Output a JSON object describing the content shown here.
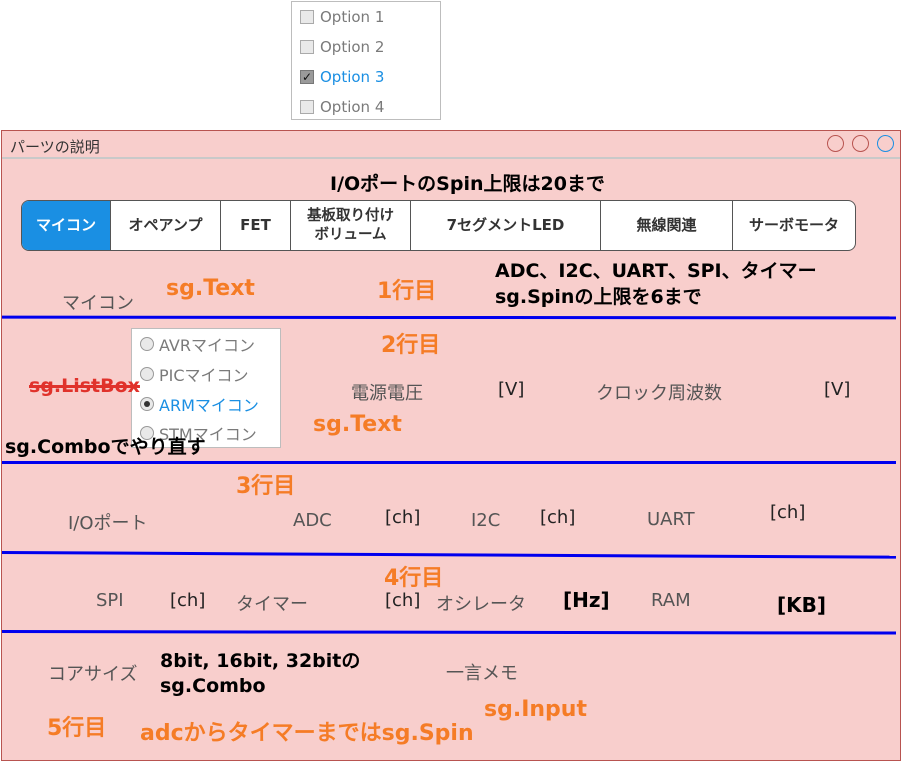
{
  "checklist": {
    "items": [
      {
        "label": "Option 1",
        "checked": false
      },
      {
        "label": "Option 2",
        "checked": false
      },
      {
        "label": "Option 3",
        "checked": true
      },
      {
        "label": "Option 4",
        "checked": false
      }
    ]
  },
  "window": {
    "title": "パーツの説明",
    "buttons": [
      "close",
      "minimize",
      "maximize"
    ]
  },
  "heading": "I/OポートのSpin上限は20まで",
  "tabs": [
    {
      "label": "マイコン",
      "active": true
    },
    {
      "label": "オペアンプ",
      "active": false
    },
    {
      "label": "FET",
      "active": false
    },
    {
      "label": "基板取り付け\nボリューム",
      "active": false
    },
    {
      "label": "7セグメントLED",
      "active": false
    },
    {
      "label": "無線関連",
      "active": false
    },
    {
      "label": "サーボモータ",
      "active": false
    }
  ],
  "row1": {
    "label": "マイコン",
    "annotation_text": "sg.Text",
    "row_marker": "1行目",
    "note_line1": "ADC、I2C、UART、SPI、タイマー",
    "note_line2": "sg.Spinの上限を6まで"
  },
  "row2": {
    "row_marker": "2行目",
    "listbox_strike": "sg.ListBox",
    "combo_note": "sg.Comboでやり直す",
    "annotation_text": "sg.Text",
    "radio_items": [
      {
        "label": "AVRマイコン",
        "selected": false
      },
      {
        "label": "PICマイコン",
        "selected": false
      },
      {
        "label": "ARMマイコン",
        "selected": true
      },
      {
        "label": "STMマイコン",
        "selected": false
      }
    ],
    "voltage_label": "電源電圧",
    "voltage_unit": "[V]",
    "clock_label": "クロック周波数",
    "clock_unit": "[V]"
  },
  "row3": {
    "row_marker": "3行目",
    "io_label": "I/Oポート",
    "adc_label": "ADC",
    "adc_unit": "[ch]",
    "i2c_label": "I2C",
    "i2c_unit": "[ch]",
    "uart_label": "UART",
    "uart_unit": "[ch]"
  },
  "row4": {
    "row_marker": "4行目",
    "spi_label": "SPI",
    "spi_unit": "[ch]",
    "timer_label": "タイマー",
    "timer_unit": "[ch]",
    "osc_label": "オシレータ",
    "osc_unit": "[Hz]",
    "ram_label": "RAM",
    "ram_unit": "[KB]"
  },
  "row5": {
    "core_label": "コアサイズ",
    "core_note_line1": "8bit, 16bit, 32bitの",
    "core_note_line2": "sg.Combo",
    "memo_label": "一言メモ",
    "input_note": "sg.Input",
    "row_marker": "5行目",
    "spin_note": "adcからタイマーまではsg.Spin"
  },
  "colors": {
    "window_bg": "#f8cecc",
    "window_border": "#b85450",
    "accent_blue": "#1a8fe3",
    "separator": "#0000ee",
    "annotation_orange": "#f57c26",
    "strike_red": "#e0322b"
  }
}
